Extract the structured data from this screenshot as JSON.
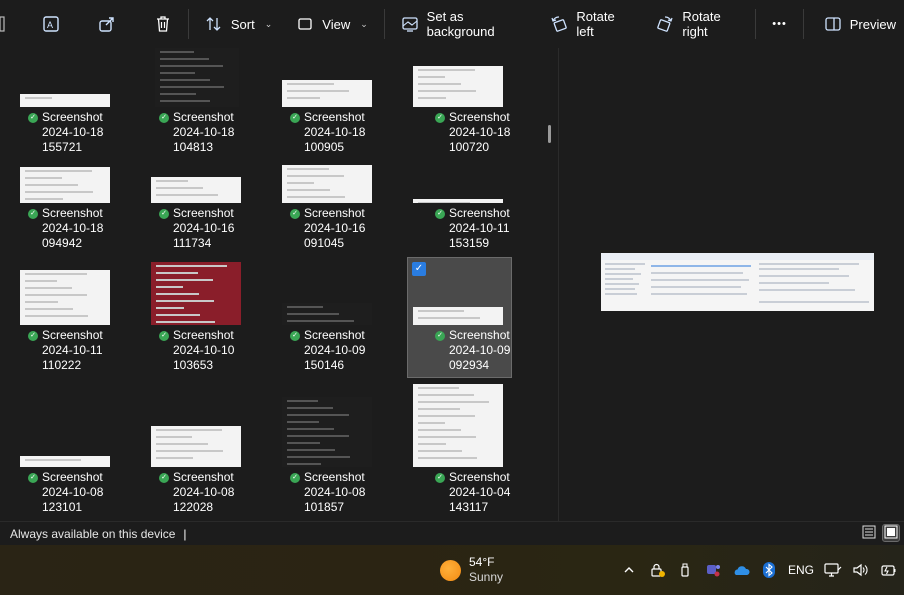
{
  "toolbar": {
    "sort_label": "Sort",
    "view_label": "View",
    "set_background_label": "Set as background",
    "rotate_left_label": "Rotate left",
    "rotate_right_label": "Rotate right",
    "more_label": "•••",
    "preview_label": "Preview"
  },
  "files": [
    {
      "title": "Screenshot",
      "date": "2024-10-18",
      "time": "155721"
    },
    {
      "title": "Screenshot",
      "date": "2024-10-18",
      "time": "104813"
    },
    {
      "title": "Screenshot",
      "date": "2024-10-18",
      "time": "100905"
    },
    {
      "title": "Screenshot",
      "date": "2024-10-18",
      "time": "100720"
    },
    {
      "title": "Screenshot",
      "date": "2024-10-18",
      "time": "094942"
    },
    {
      "title": "Screenshot",
      "date": "2024-10-16",
      "time": "111734"
    },
    {
      "title": "Screenshot",
      "date": "2024-10-16",
      "time": "091045"
    },
    {
      "title": "Screenshot",
      "date": "2024-10-11",
      "time": "153159"
    },
    {
      "title": "Screenshot",
      "date": "2024-10-11",
      "time": "110222"
    },
    {
      "title": "Screenshot",
      "date": "2024-10-10",
      "time": "103653"
    },
    {
      "title": "Screenshot",
      "date": "2024-10-09",
      "time": "150146"
    },
    {
      "title": "Screenshot",
      "date": "2024-10-09",
      "time": "092934"
    },
    {
      "title": "Screenshot",
      "date": "2024-10-08",
      "time": "123101"
    },
    {
      "title": "Screenshot",
      "date": "2024-10-08",
      "time": "122028"
    },
    {
      "title": "Screenshot",
      "date": "2024-10-08",
      "time": "101857"
    },
    {
      "title": "Screenshot",
      "date": "2024-10-04",
      "time": "143117"
    }
  ],
  "statusbar": {
    "text": "Always available on this device"
  },
  "taskbar": {
    "temp": "54°F",
    "condition": "Sunny",
    "language": "ENG"
  },
  "colors": {
    "background": "#1c1c1c",
    "sync_ok": "#3aa655",
    "selection_check": "#2a7de1"
  }
}
